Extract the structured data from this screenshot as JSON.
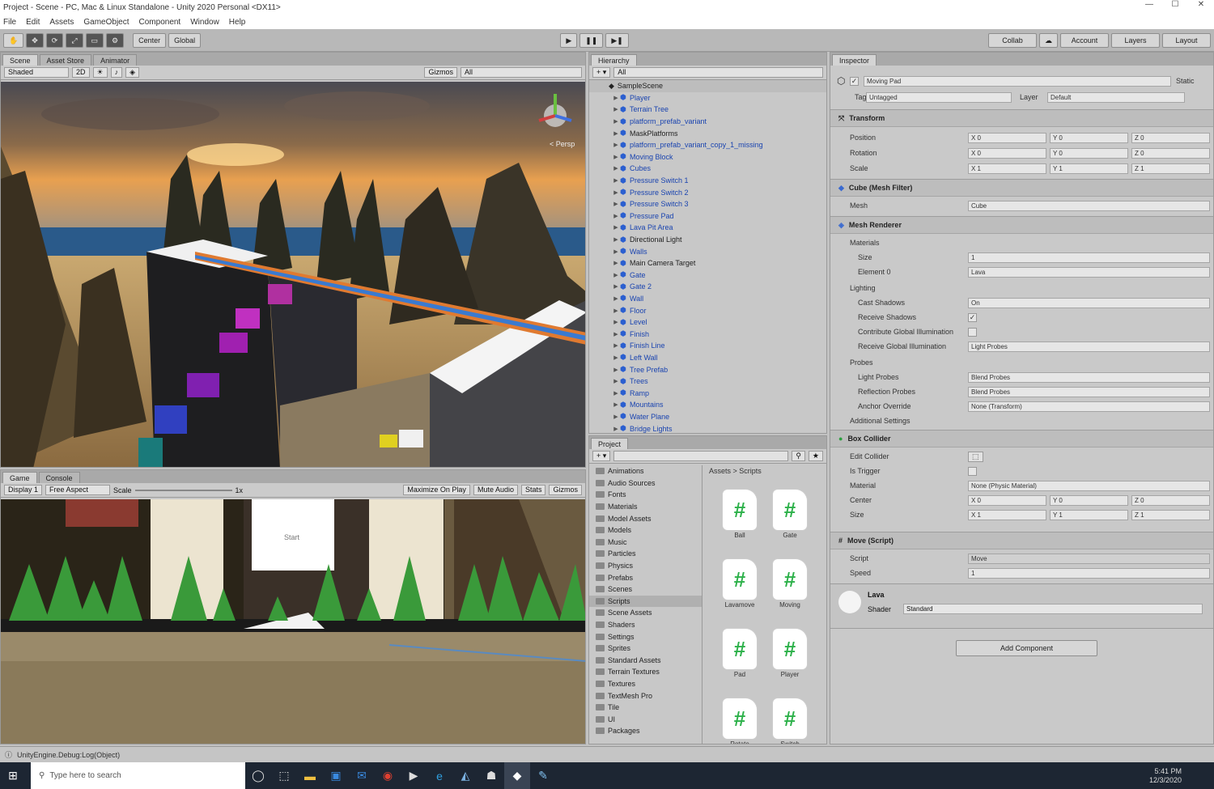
{
  "window": {
    "title": "Project - Scene - PC, Mac & Linux Standalone - Unity 2020 Personal <DX11>"
  },
  "menu": [
    "File",
    "Edit",
    "Assets",
    "GameObject",
    "Component",
    "Window",
    "Help"
  ],
  "toolbar": {
    "transform_tools": [
      "✋",
      "✥",
      "⟳",
      "⤢",
      "▭",
      "⚙"
    ],
    "pivot_label": "Center",
    "space_label": "Global",
    "play": "▶",
    "pause": "❚❚",
    "step": "▶❚",
    "collab_label": "Collab",
    "cloud_icon": "☁",
    "account_label": "Account",
    "layers_label": "Layers",
    "layout_label": "Layout"
  },
  "scene": {
    "tabs": [
      "Scene",
      "Asset Store",
      "Animator"
    ],
    "shading_mode": "Shaded",
    "mode_2d": "2D",
    "gizmos_label": "Gizmos",
    "search_placeholder": "All",
    "persp_label": "< Persp"
  },
  "game": {
    "tabs": [
      "Game",
      "Console"
    ],
    "display": "Display 1",
    "aspect": "Free Aspect",
    "scale_label": "Scale",
    "scale_value": "1x",
    "maximize": "Maximize On Play",
    "mute": "Mute Audio",
    "stats": "Stats",
    "gizmos": "Gizmos",
    "ui_text": "Start"
  },
  "hierarchy": {
    "title": "Hierarchy",
    "create_label": "+ ▾",
    "search_placeholder": "All",
    "scene_name": "SampleScene",
    "items": [
      {
        "name": "Player",
        "blue": true,
        "depth": 1
      },
      {
        "name": "Terrain Tree",
        "blue": true,
        "depth": 1
      },
      {
        "name": "platform_prefab_variant",
        "blue": true,
        "depth": 1
      },
      {
        "name": "MaskPlatforms",
        "blue": false,
        "depth": 1
      },
      {
        "name": "platform_prefab_variant_copy_1_missing",
        "blue": true,
        "depth": 1
      },
      {
        "name": "Moving Block",
        "blue": true,
        "depth": 1
      },
      {
        "name": "Cubes",
        "blue": true,
        "depth": 1
      },
      {
        "name": "Pressure Switch 1",
        "blue": true,
        "depth": 1
      },
      {
        "name": "Pressure Switch 2",
        "blue": true,
        "depth": 1
      },
      {
        "name": "Pressure Switch 3",
        "blue": true,
        "depth": 1
      },
      {
        "name": "Pressure Pad",
        "blue": true,
        "depth": 1
      },
      {
        "name": "Lava Pit Area",
        "blue": true,
        "depth": 1
      },
      {
        "name": "Directional Light",
        "blue": false,
        "depth": 1
      },
      {
        "name": "Walls",
        "blue": true,
        "depth": 1
      },
      {
        "name": "Main Camera Target",
        "blue": false,
        "depth": 1
      },
      {
        "name": "Gate",
        "blue": true,
        "depth": 1
      },
      {
        "name": "Gate 2",
        "blue": true,
        "depth": 1
      },
      {
        "name": "Wall",
        "blue": true,
        "depth": 1
      },
      {
        "name": "Floor",
        "blue": true,
        "depth": 1
      },
      {
        "name": "Level",
        "blue": true,
        "depth": 1
      },
      {
        "name": "Finish",
        "blue": true,
        "depth": 1
      },
      {
        "name": "Finish Line",
        "blue": true,
        "depth": 1
      },
      {
        "name": "Left Wall",
        "blue": true,
        "depth": 1
      },
      {
        "name": "Tree Prefab",
        "blue": true,
        "depth": 1
      },
      {
        "name": "Trees",
        "blue": true,
        "depth": 1
      },
      {
        "name": "Ramp",
        "blue": true,
        "depth": 1
      },
      {
        "name": "Mountains",
        "blue": true,
        "depth": 1
      },
      {
        "name": "Water Plane",
        "blue": true,
        "depth": 1
      },
      {
        "name": "Bridge Lights",
        "blue": true,
        "depth": 1
      }
    ]
  },
  "project": {
    "title": "Project",
    "search_placeholder": "",
    "breadcrumb": "Assets > Scripts",
    "folders": [
      "Animations",
      "Audio Sources",
      "Fonts",
      "Materials",
      "Model Assets",
      "Models",
      "Music",
      "Particles",
      "Physics",
      "Prefabs",
      "Scenes",
      "Scripts",
      "Scene Assets",
      "Shaders",
      "Settings",
      "Sprites",
      "Standard Assets",
      "Terrain Textures",
      "Textures",
      "TextMesh Pro",
      "Tile",
      "UI",
      "Packages"
    ],
    "assets": [
      "Ball",
      "Gate",
      "Lavamove",
      "Moving",
      "Pad",
      "Player",
      "Rotate",
      "Switch"
    ],
    "hash_glyph": "#"
  },
  "inspector": {
    "title": "Inspector",
    "static_label": "Static",
    "object_name": "Moving Pad",
    "tag_label": "Tag",
    "tag_value": "Untagged",
    "layer_label": "Layer",
    "layer_value": "Default",
    "transform": {
      "title": "Transform",
      "rows": [
        {
          "label": "Position",
          "x": "X 0",
          "y": "Y 0",
          "z": "Z 0"
        },
        {
          "label": "Rotation",
          "x": "X 0",
          "y": "Y 0",
          "z": "Z 0"
        },
        {
          "label": "Scale",
          "x": "X 1",
          "y": "Y 1",
          "z": "Z 1"
        }
      ]
    },
    "meshfilter": {
      "title": "Cube (Mesh Filter)",
      "mesh_label": "Mesh",
      "mesh_value": "Cube"
    },
    "meshrenderer": {
      "title": "Mesh Renderer",
      "materials": "Materials",
      "size_label": "Size",
      "size_value": "1",
      "element_label": "Element 0",
      "element_value": "Lava",
      "lighting": "Lighting",
      "cast_shadows": "Cast Shadows",
      "cast_shadows_value": "On",
      "receive_shadows": "Receive Shadows",
      "contribute_gi": "Contribute Global Illumination",
      "receive_gi": "Receive Global Illumination",
      "receive_gi_value": "Light Probes",
      "probes": "Probes",
      "light_probes": "Light Probes",
      "light_probes_value": "Blend Probes",
      "reflection_probes": "Reflection Probes",
      "reflection_value": "Blend Probes",
      "anchor_override": "Anchor Override",
      "anchor_value": "None (Transform)",
      "additional": "Additional Settings"
    },
    "boxcollider": {
      "title": "Box Collider",
      "edit_collider": "Edit Collider",
      "is_trigger": "Is Trigger",
      "material": "Material",
      "material_value": "None (Physic Material)",
      "center": "Center",
      "size": "Size",
      "center_v": [
        "X 0",
        "Y 0",
        "Z 0"
      ],
      "size_v": [
        "X 1",
        "Y 1",
        "Z 1"
      ]
    },
    "script": {
      "title": "Move (Script)",
      "script_label": "Script",
      "script_value": "Move",
      "speed_label": "Speed",
      "speed_value": "1"
    },
    "material": {
      "name": "Lava",
      "shader_label": "Shader",
      "shader_value": "Standard"
    },
    "add_component": "Add Component"
  },
  "status": {
    "text": "UnityEngine.Debug:Log(Object)"
  },
  "taskbar": {
    "search_placeholder": "Type here to search",
    "time": "5:41 PM",
    "date": "12/3/2020"
  },
  "colors": {
    "link": "#1a44b0",
    "toolbar": "#b8b8b8",
    "panel": "#c8c8c8",
    "taskbar": "#1d2633",
    "script_green": "#2db14a"
  }
}
